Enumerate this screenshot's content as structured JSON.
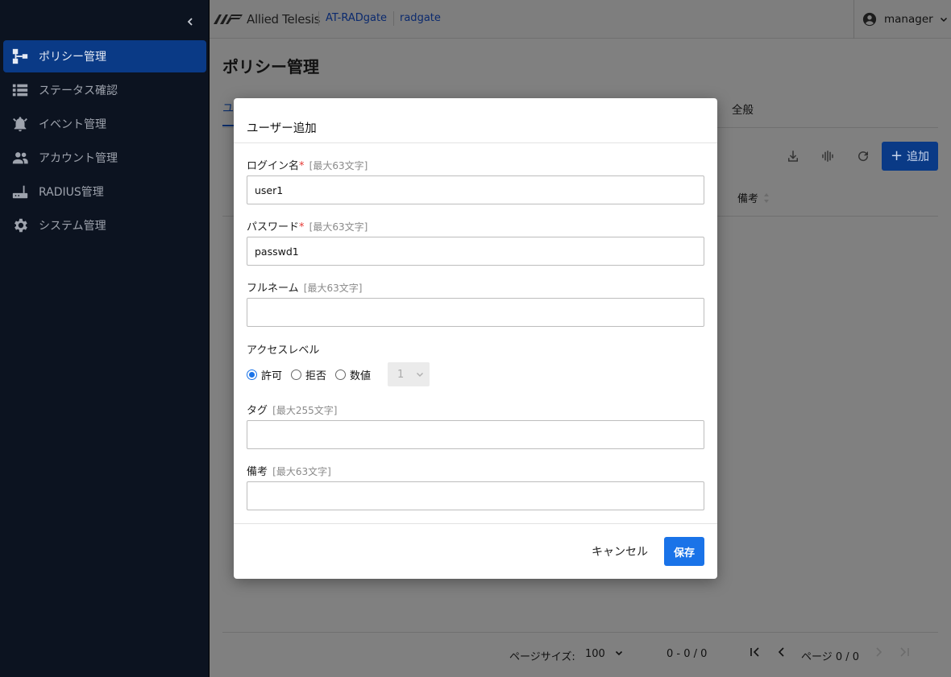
{
  "colors": {
    "sidebar_bg": "#0c1320",
    "nav_active": "#0a3a86",
    "primary": "#1a73e8",
    "required": "#e53935",
    "overlay": "#808080"
  },
  "sidebar": {
    "collapse_icon": "chevron-left-icon",
    "items": [
      {
        "label": "ポリシー管理",
        "icon": "sitemap-icon",
        "active": true
      },
      {
        "label": "ステータス確認",
        "icon": "list-icon",
        "active": false
      },
      {
        "label": "イベント管理",
        "icon": "bell-icon",
        "active": false
      },
      {
        "label": "アカウント管理",
        "icon": "people-icon",
        "active": false
      },
      {
        "label": "RADIUS管理",
        "icon": "router-icon",
        "active": false
      },
      {
        "label": "システム管理",
        "icon": "gear-icon",
        "active": false
      }
    ]
  },
  "header": {
    "logo_text": "Allied Telesis",
    "breadcrumb": [
      "AT-RADgate",
      "radgate"
    ],
    "user": "manager"
  },
  "main": {
    "title": "ポリシー管理",
    "tab_peek": "ユ",
    "tab_general": "全般",
    "add_button": "追加",
    "column_header": "備考",
    "pager": {
      "page_size_label": "ページサイズ:",
      "page_size": "100",
      "range": "0 - 0 / 0",
      "page_label": "ページ 0 / 0"
    }
  },
  "modal": {
    "title": "ユーザー追加",
    "fields": {
      "login": {
        "label": "ログイン名",
        "required": "*",
        "hint": "[最大63文字]",
        "value": "user1"
      },
      "password": {
        "label": "パスワード",
        "required": "*",
        "hint": "[最大63文字]",
        "value": "passwd1"
      },
      "fullname": {
        "label": "フルネーム",
        "hint": "[最大63文字]",
        "value": ""
      },
      "tag": {
        "label": "タグ",
        "hint": "[最大255文字]",
        "value": ""
      },
      "note": {
        "label": "備考",
        "hint": "[最大63文字]",
        "value": ""
      }
    },
    "access_level": {
      "label": "アクセスレベル",
      "options": [
        "許可",
        "拒否",
        "数値"
      ],
      "selected": "許可",
      "numeric_value": "1"
    },
    "cancel_label": "キャンセル",
    "save_label": "保存"
  }
}
